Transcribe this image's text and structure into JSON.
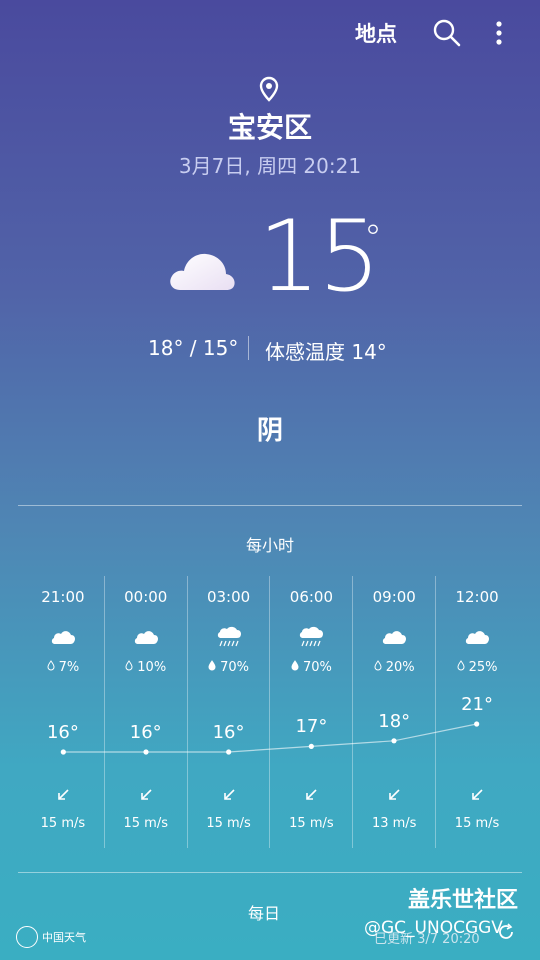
{
  "header": {
    "location_button": "地点"
  },
  "location": {
    "city": "宝安区",
    "datetime": "3月7日, 周四 20:21"
  },
  "current": {
    "temp": "15",
    "degree": "°",
    "hilo": "18° / 15°",
    "feels_like": "体感温度 14°",
    "condition": "阴"
  },
  "hourly": {
    "title": "每小时",
    "items": [
      {
        "time": "21:00",
        "icon": "cloudy-icon",
        "precip": "7%",
        "temp": "16°",
        "temp_value": 16,
        "wind": "15 m/s"
      },
      {
        "time": "00:00",
        "icon": "cloudy-icon",
        "precip": "10%",
        "temp": "16°",
        "temp_value": 16,
        "wind": "15 m/s"
      },
      {
        "time": "03:00",
        "icon": "rain-icon",
        "precip": "70%",
        "temp": "16°",
        "temp_value": 16,
        "wind": "15 m/s"
      },
      {
        "time": "06:00",
        "icon": "rain-icon",
        "precip": "70%",
        "temp": "17°",
        "temp_value": 17,
        "wind": "15 m/s"
      },
      {
        "time": "09:00",
        "icon": "cloudy-icon",
        "precip": "20%",
        "temp": "18°",
        "temp_value": 18,
        "wind": "13 m/s"
      },
      {
        "time": "12:00",
        "icon": "cloudy-icon",
        "precip": "25%",
        "temp": "21°",
        "temp_value": 21,
        "wind": "15 m/s"
      }
    ]
  },
  "daily": {
    "title": "每日"
  },
  "footer": {
    "updated": "已更新 3/7 20:20",
    "logo_text": "中国天气",
    "watermark_site": "盖乐世社区",
    "watermark_user": "@GC_UNOCGGV"
  }
}
